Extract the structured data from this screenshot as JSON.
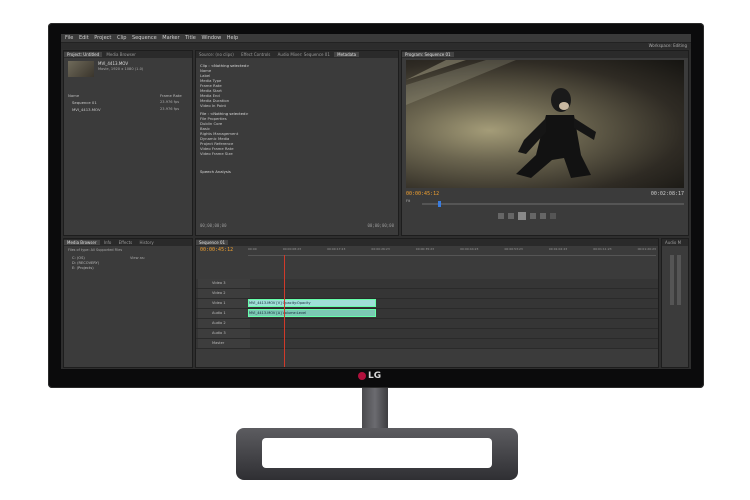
{
  "menu": [
    "File",
    "Edit",
    "Project",
    "Clip",
    "Sequence",
    "Marker",
    "Title",
    "Window",
    "Help"
  ],
  "workspace": {
    "label": "Workspace:",
    "value": "Editing"
  },
  "source_panel": {
    "tabs": [
      "Project: Untitled",
      "Media Browser"
    ],
    "clip_name": "MVI_4413.MOV",
    "clip_info": "Movie, 1920 x 1080 (1.0)",
    "items_header": "Name",
    "items": [
      "Sequence 01",
      "MVI_4413.MOV"
    ],
    "frame_rate_header": "Frame Rate",
    "frame_rates": [
      "23.976 fps",
      "23.976 fps"
    ]
  },
  "metadata_panel": {
    "tabs": [
      "Source: (no clips)",
      "Effect Controls",
      "Audio Mixer: Sequence 01",
      "Metadata"
    ],
    "rows": [
      "Clip : <Nothing selected>",
      "Name",
      "Label",
      "Media Type",
      "Frame Rate",
      "Media Start",
      "Media End",
      "Media Duration",
      "Video In Point"
    ],
    "file_rows": [
      "File : <Nothing selected>",
      "File Properties",
      "Dublin Core",
      "Basic",
      "Rights Management",
      "Dynamic Media",
      "Project Reference",
      "Video Frame Rate",
      "Video Frame Size"
    ],
    "speech": "Speech Analysis",
    "timecode_left": "00;00;00;00",
    "timecode_right": "00;00;00;00"
  },
  "program_panel": {
    "tab": "Program: Sequence 01",
    "timecode_current": "00:00:45:12",
    "timecode_duration": "00:02:08:17",
    "fit": "Fit"
  },
  "media_browser": {
    "tabs": [
      "Media Browser",
      "Info",
      "Effects",
      "History"
    ],
    "items": [
      "C: (OS)",
      "D: (RECOVERY)",
      "E: (Projects)"
    ],
    "view_as": "View as:",
    "files_of_type": "Files of type: All Supported Files"
  },
  "timeline": {
    "tab": "Sequence 01",
    "timecode": "00:00:45:12",
    "ruler": [
      "00:00",
      "00:00:08:23",
      "00:00:17:23",
      "00:00:26:23",
      "00:00:35:23",
      "00:00:44:23",
      "00:00:53:23",
      "00:01:02:23",
      "00:01:11:23",
      "00:01:20:23"
    ],
    "tracks": [
      "Video 3",
      "Video 2",
      "Video 1",
      "Audio 1",
      "Audio 2",
      "Audio 3",
      "Master"
    ],
    "video_clip": "MVI_4413.MOV [V]  Opacity:Opacity",
    "audio_clip": "MVI_4413.MOV [A]  Volume:Level"
  },
  "audio_meter": {
    "label": "Audio M"
  },
  "brand": "LG"
}
